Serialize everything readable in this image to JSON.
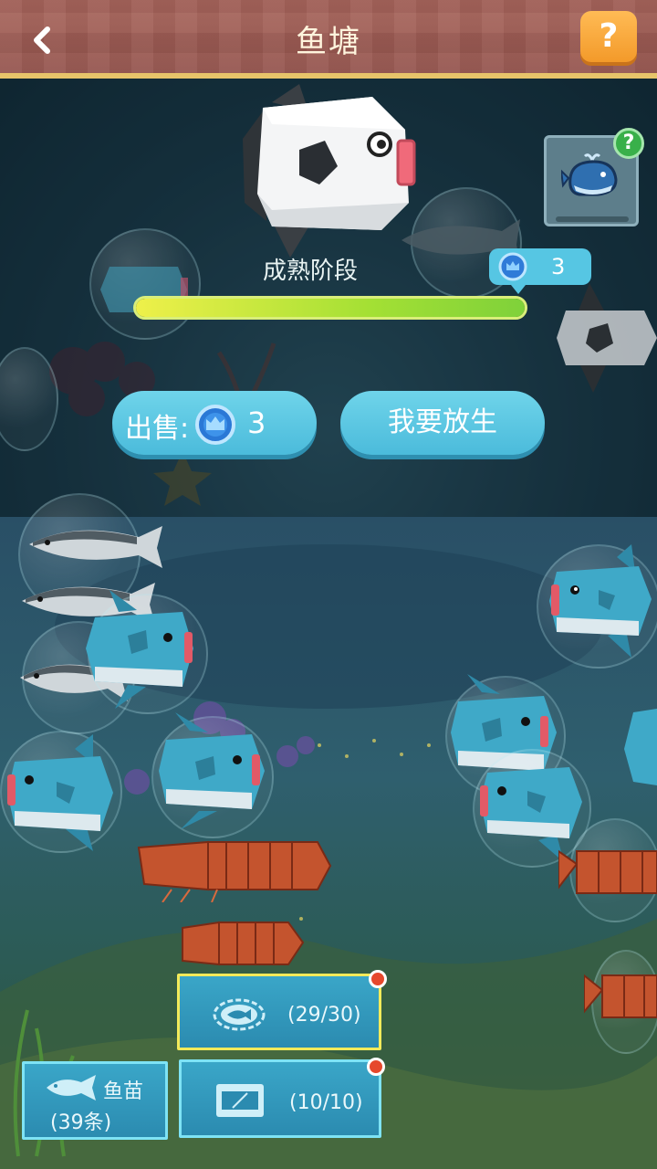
{
  "header": {
    "title": "鱼塘",
    "back_icon": "chevron-left-icon",
    "help_label": "?"
  },
  "detail": {
    "stage_label": "成熟阶段",
    "growth_progress": 1.0,
    "price_tag_value": "3",
    "sell_label": "出售:",
    "sell_value": "3",
    "release_label": "我要放生",
    "whale_badge": "?"
  },
  "tray": {
    "pond_capacity": "(29/30)",
    "fry_label": "鱼苗",
    "fry_count": "(39条)",
    "tank_capacity": "(10/10)"
  },
  "colors": {
    "accent": "#56c6e3",
    "header": "#a8655c",
    "progress": "#a4e034",
    "badge": "#e6482d"
  }
}
